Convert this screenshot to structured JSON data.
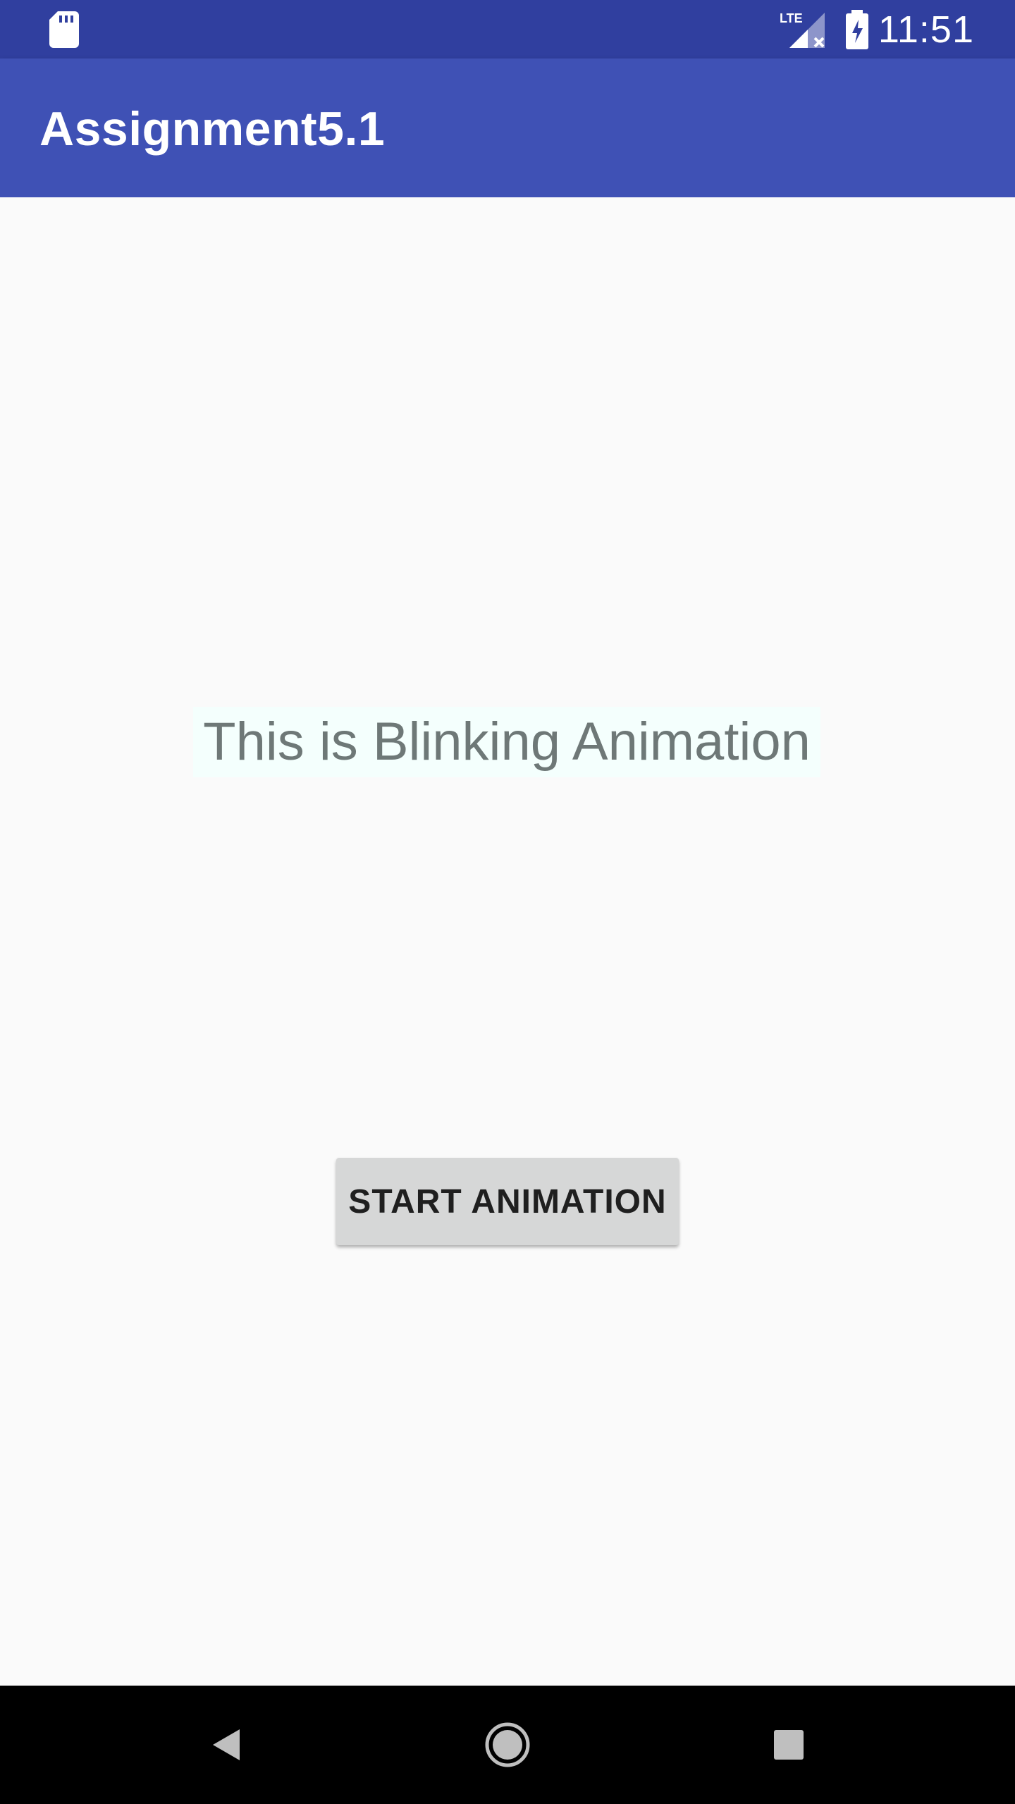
{
  "status_bar": {
    "time": "11:51",
    "network_label": "LTE",
    "icons": [
      "sd-card-icon",
      "signal-lte-icon",
      "battery-charging-icon"
    ]
  },
  "app_bar": {
    "title": "Assignment5.1",
    "color": "#3f51b5",
    "status_color": "#303f9f"
  },
  "main": {
    "blink_text": "This is Blinking Animation",
    "start_button_label": "START ANIMATION"
  },
  "nav_bar": {
    "icons": [
      "back-icon",
      "home-icon",
      "recents-icon"
    ]
  }
}
